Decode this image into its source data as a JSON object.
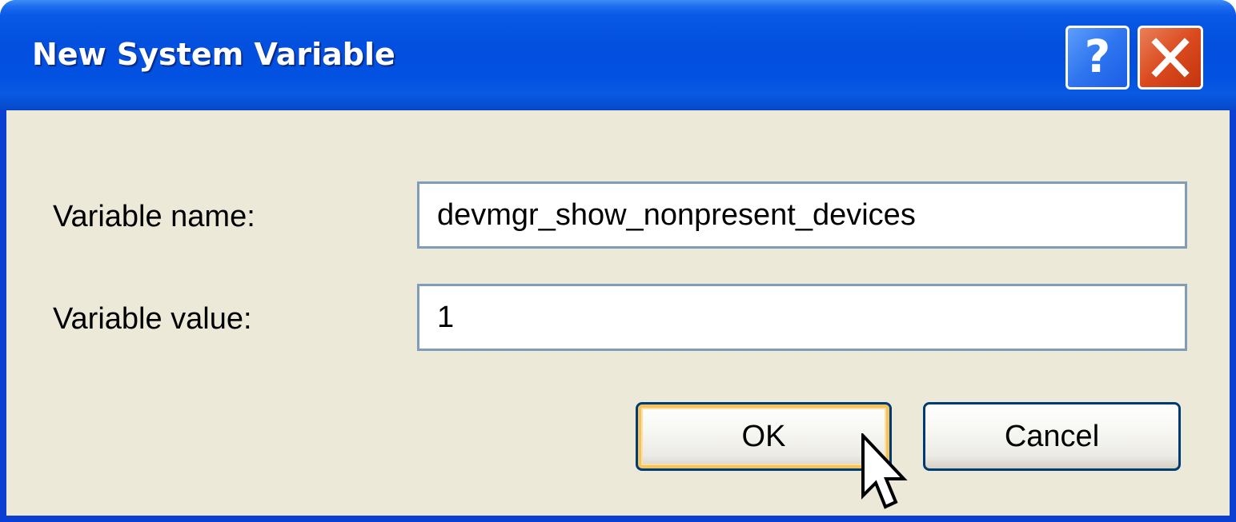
{
  "window": {
    "title": "New System Variable",
    "help_glyph": "?",
    "close_icon": "close-x-icon"
  },
  "form": {
    "name_label": "Variable name:",
    "name_value": "devmgr_show_nonpresent_devices",
    "value_label": "Variable value:",
    "value_value": "1"
  },
  "buttons": {
    "ok_label": "OK",
    "cancel_label": "Cancel"
  },
  "colors": {
    "titlebar": "#0350df",
    "client_bg": "#ece9d8",
    "close_button": "#db4a1e",
    "textbox_border": "#7f9db9",
    "default_button_highlight": "#f6c25e"
  }
}
